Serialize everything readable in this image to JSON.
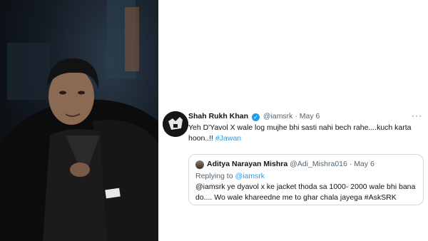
{
  "tweet": {
    "author_name": "Shah Rukh Khan",
    "author_handle": "@iamsrk",
    "separator": "·",
    "date": "May 6",
    "text": "Yeh D'Yavol X wale log mujhe bhi sasti nahi bech rahe....kuch karta hoon..!! ",
    "hashtag": "#Jawan",
    "more_icon": "more-icon"
  },
  "quoted": {
    "author_name": "Aditya Narayan Mishra",
    "author_handle": "@Adi_Mishra016",
    "separator": "·",
    "date": "May 6",
    "replying_prefix": "Replying to ",
    "replying_handle": "@iamsrk",
    "text": "@iamsrk ye dyavol x  ke jacket thoda sa 1000- 2000 wale bhi bana do.... Wo wale khareedne me to ghar chala jayega #AskSRK"
  },
  "colors": {
    "link": "#1d9bf0",
    "verified": "#1d9bf0",
    "muted": "#536471",
    "text": "#0f1419"
  }
}
